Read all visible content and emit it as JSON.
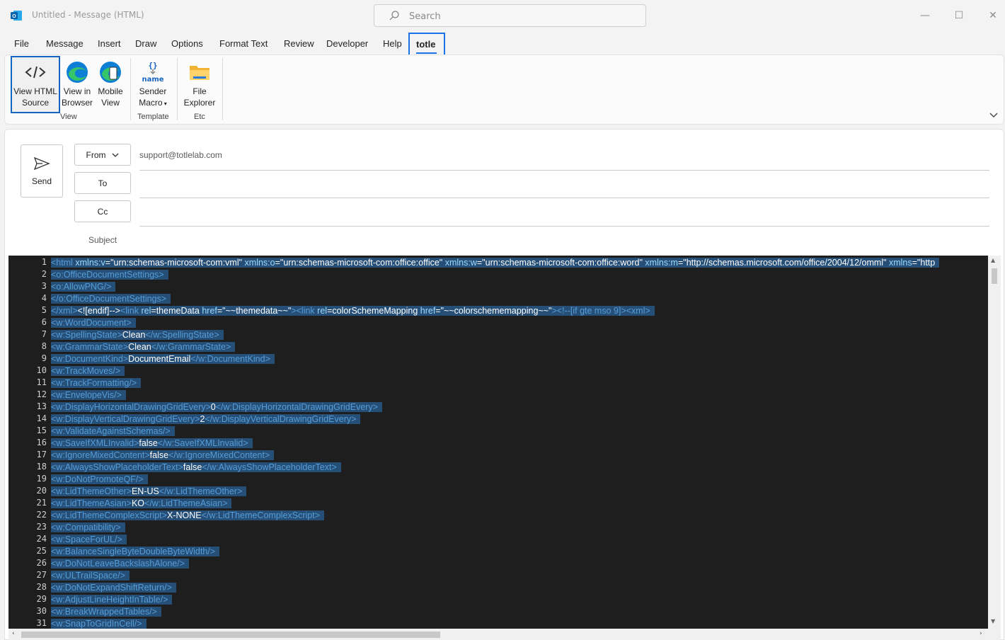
{
  "window": {
    "title": "Untitled  -  Message (HTML)",
    "search_placeholder": "Search",
    "minimize_glyph": "—",
    "maximize_glyph": "☐",
    "close_glyph": "✕"
  },
  "menu": {
    "items": [
      "File",
      "Message",
      "Insert",
      "Draw",
      "Options",
      "Format Text",
      "Review",
      "Developer",
      "Help"
    ],
    "active": "totle"
  },
  "ribbon": {
    "view_html_source": [
      "View HTML",
      "Source"
    ],
    "view_in_browser": [
      "View in",
      "Browser"
    ],
    "mobile_view": [
      "Mobile",
      "View"
    ],
    "sender_macro": [
      "Sender",
      "Macro"
    ],
    "sender_macro_icon_text": "name",
    "file_explorer": [
      "File",
      "Explorer"
    ],
    "groups": {
      "view": "View",
      "template": "Template",
      "etc": "Etc"
    }
  },
  "compose": {
    "send_label": "Send",
    "from_label": "From",
    "from_value": "support@totlelab.com",
    "to_label": "To",
    "cc_label": "Cc",
    "subject_label": "Subject"
  },
  "editor": {
    "line_numbers": [
      "1",
      "2",
      "3",
      "4",
      "5",
      "6",
      "7",
      "8",
      "9",
      "10",
      "11",
      "12",
      "13",
      "14",
      "15",
      "16",
      "17",
      "18",
      "19",
      "20",
      "21",
      "22",
      "23",
      "24",
      "25",
      "26",
      "27",
      "28",
      "29",
      "30",
      "31"
    ],
    "lines": [
      [
        {
          "t": "t",
          "v": "<html "
        },
        {
          "t": "a",
          "v": "xmlns:v"
        },
        {
          "t": "s",
          "v": "=\"urn:schemas-microsoft-com:vml\" "
        },
        {
          "t": "a",
          "v": "xmlns:o"
        },
        {
          "t": "s",
          "v": "=\"urn:schemas-microsoft-com:office:office\" "
        },
        {
          "t": "a",
          "v": "xmlns:w"
        },
        {
          "t": "s",
          "v": "=\"urn:schemas-microsoft-com:office:word\" "
        },
        {
          "t": "a",
          "v": "xmlns:m"
        },
        {
          "t": "s",
          "v": "=\"http://schemas.microsoft.com/office/2004/12/omml\" "
        },
        {
          "t": "a",
          "v": "xmlns"
        },
        {
          "t": "s",
          "v": "=\"http"
        }
      ],
      [
        {
          "t": "t",
          "v": "<o:OfficeDocumentSettings>"
        }
      ],
      [
        {
          "t": "t",
          "v": "<o:AllowPNG/>"
        }
      ],
      [
        {
          "t": "t",
          "v": "</o:OfficeDocumentSettings>"
        }
      ],
      [
        {
          "t": "t",
          "v": "</xml>"
        },
        {
          "t": "s",
          "v": "<![endif]-->"
        },
        {
          "t": "t",
          "v": "<link "
        },
        {
          "t": "a",
          "v": "rel"
        },
        {
          "t": "s",
          "v": "=themeData "
        },
        {
          "t": "a",
          "v": "href"
        },
        {
          "t": "s",
          "v": "=\"~~themedata~~\""
        },
        {
          "t": "t",
          "v": "><link "
        },
        {
          "t": "a",
          "v": "rel"
        },
        {
          "t": "s",
          "v": "=colorSchemeMapping "
        },
        {
          "t": "a",
          "v": "href"
        },
        {
          "t": "s",
          "v": "=\"~~colorschememapping~~\""
        },
        {
          "t": "t",
          "v": "><!--[if gte mso 9]><xml>"
        }
      ],
      [
        {
          "t": "t",
          "v": "<w:WordDocument>"
        }
      ],
      [
        {
          "t": "t",
          "v": "<w:SpellingState>"
        },
        {
          "t": "s",
          "v": "Clean"
        },
        {
          "t": "t",
          "v": "</w:SpellingState>"
        }
      ],
      [
        {
          "t": "t",
          "v": "<w:GrammarState>"
        },
        {
          "t": "s",
          "v": "Clean"
        },
        {
          "t": "t",
          "v": "</w:GrammarState>"
        }
      ],
      [
        {
          "t": "t",
          "v": "<w:DocumentKind>"
        },
        {
          "t": "s",
          "v": "DocumentEmail"
        },
        {
          "t": "t",
          "v": "</w:DocumentKind>"
        }
      ],
      [
        {
          "t": "t",
          "v": "<w:TrackMoves/>"
        }
      ],
      [
        {
          "t": "t",
          "v": "<w:TrackFormatting/>"
        }
      ],
      [
        {
          "t": "t",
          "v": "<w:EnvelopeVis/>"
        }
      ],
      [
        {
          "t": "t",
          "v": "<w:DisplayHorizontalDrawingGridEvery>"
        },
        {
          "t": "s",
          "v": "0"
        },
        {
          "t": "t",
          "v": "</w:DisplayHorizontalDrawingGridEvery>"
        }
      ],
      [
        {
          "t": "t",
          "v": "<w:DisplayVerticalDrawingGridEvery>"
        },
        {
          "t": "s",
          "v": "2"
        },
        {
          "t": "t",
          "v": "</w:DisplayVerticalDrawingGridEvery>"
        }
      ],
      [
        {
          "t": "t",
          "v": "<w:ValidateAgainstSchemas/>"
        }
      ],
      [
        {
          "t": "t",
          "v": "<w:SaveIfXMLInvalid>"
        },
        {
          "t": "s",
          "v": "false"
        },
        {
          "t": "t",
          "v": "</w:SaveIfXMLInvalid>"
        }
      ],
      [
        {
          "t": "t",
          "v": "<w:IgnoreMixedContent>"
        },
        {
          "t": "s",
          "v": "false"
        },
        {
          "t": "t",
          "v": "</w:IgnoreMixedContent>"
        }
      ],
      [
        {
          "t": "t",
          "v": "<w:AlwaysShowPlaceholderText>"
        },
        {
          "t": "s",
          "v": "false"
        },
        {
          "t": "t",
          "v": "</w:AlwaysShowPlaceholderText>"
        }
      ],
      [
        {
          "t": "t",
          "v": "<w:DoNotPromoteQF/>"
        }
      ],
      [
        {
          "t": "t",
          "v": "<w:LidThemeOther>"
        },
        {
          "t": "s",
          "v": "EN-US"
        },
        {
          "t": "t",
          "v": "</w:LidThemeOther>"
        }
      ],
      [
        {
          "t": "t",
          "v": "<w:LidThemeAsian>"
        },
        {
          "t": "s",
          "v": "KO"
        },
        {
          "t": "t",
          "v": "</w:LidThemeAsian>"
        }
      ],
      [
        {
          "t": "t",
          "v": "<w:LidThemeComplexScript>"
        },
        {
          "t": "s",
          "v": "X-NONE"
        },
        {
          "t": "t",
          "v": "</w:LidThemeComplexScript>"
        }
      ],
      [
        {
          "t": "t",
          "v": "<w:Compatibility>"
        }
      ],
      [
        {
          "t": "t",
          "v": "<w:SpaceForUL/>"
        }
      ],
      [
        {
          "t": "t",
          "v": "<w:BalanceSingleByteDoubleByteWidth/>"
        }
      ],
      [
        {
          "t": "t",
          "v": "<w:DoNotLeaveBackslashAlone/>"
        }
      ],
      [
        {
          "t": "t",
          "v": "<w:ULTrailSpace/>"
        }
      ],
      [
        {
          "t": "t",
          "v": "<w:DoNotExpandShiftReturn/>"
        }
      ],
      [
        {
          "t": "t",
          "v": "<w:AdjustLineHeightInTable/>"
        }
      ],
      [
        {
          "t": "t",
          "v": "<w:BreakWrappedTables/>"
        }
      ],
      [
        {
          "t": "t",
          "v": "<w:SnapToGridInCell/>"
        }
      ]
    ]
  },
  "colors": {
    "accent": "#1a73e8",
    "editor_bg": "#1e1e1e",
    "selection": "#264f78",
    "tag": "#569cd6",
    "attr": "#9cdcfe",
    "value": "#ffffff"
  }
}
